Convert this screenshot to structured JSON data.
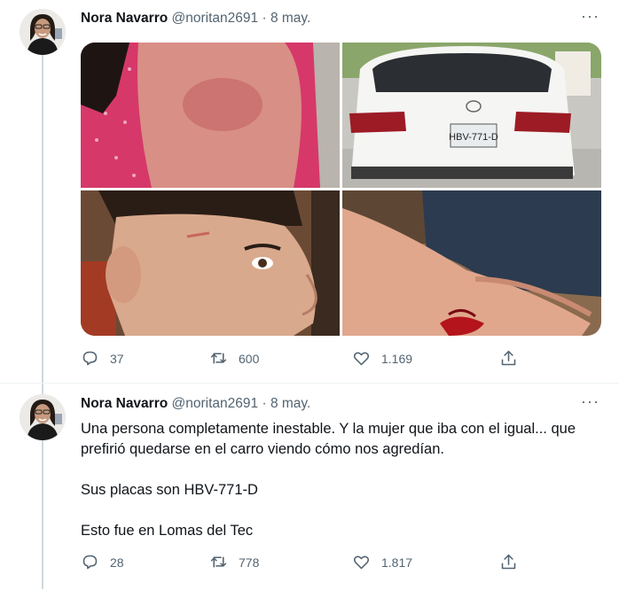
{
  "tweets": [
    {
      "author_name": "Nora Navarro",
      "handle": "@noritan2691",
      "separator": "·",
      "date": "8 may.",
      "more_label": "···",
      "media": {
        "car_plate_text": "HBV-771-D"
      },
      "counts": {
        "replies": "37",
        "retweets": "600",
        "likes": "1.169"
      }
    },
    {
      "author_name": "Nora Navarro",
      "handle": "@noritan2691",
      "separator": "·",
      "date": "8 may.",
      "more_label": "···",
      "text_lines": [
        "Una persona completamente inestable. Y la mujer que iba con el igual... que",
        "prefirió quedarse en el carro viendo cómo nos agredían.",
        "Sus placas son HBV-771-D",
        "Esto fue en Lomas del Tec"
      ],
      "counts": {
        "replies": "28",
        "retweets": "778",
        "likes": "1.817"
      }
    }
  ],
  "colors": {
    "text": "#0f1419",
    "secondary": "#536471",
    "thread_line": "#cfd9de"
  },
  "icons": [
    "reply-icon",
    "retweet-icon",
    "like-icon",
    "share-icon",
    "more-icon"
  ]
}
